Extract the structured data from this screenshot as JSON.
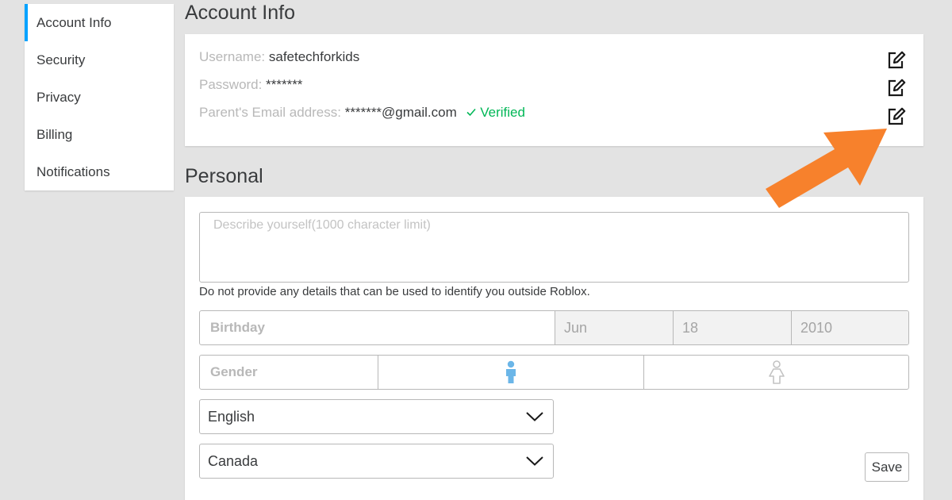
{
  "sidebar": {
    "items": [
      {
        "label": "Account Info",
        "active": true
      },
      {
        "label": "Security"
      },
      {
        "label": "Privacy"
      },
      {
        "label": "Billing"
      },
      {
        "label": "Notifications"
      }
    ]
  },
  "account": {
    "title": "Account Info",
    "username_label": "Username:",
    "username_value": "safetechforkids",
    "password_label": "Password:",
    "password_value": "*******",
    "email_label": "Parent's Email address:",
    "email_value": "*******@gmail.com",
    "verified_label": "Verified",
    "edit_icon": "edit-icon"
  },
  "personal": {
    "title": "Personal",
    "describe_placeholder": "Describe yourself(1000 character limit)",
    "disclaimer": "Do not provide any details that can be used to identify you outside Roblox.",
    "birthday_label": "Birthday",
    "birthday_month": "Jun",
    "birthday_day": "18",
    "birthday_year": "2010",
    "gender_label": "Gender",
    "language": "English",
    "country": "Canada",
    "save_label": "Save"
  },
  "colors": {
    "accent": "#00a2ff",
    "verified": "#02b757",
    "arrow": "#f7812c",
    "male_active": "#6bb6e8",
    "female_inactive": "#c3c3c3"
  }
}
